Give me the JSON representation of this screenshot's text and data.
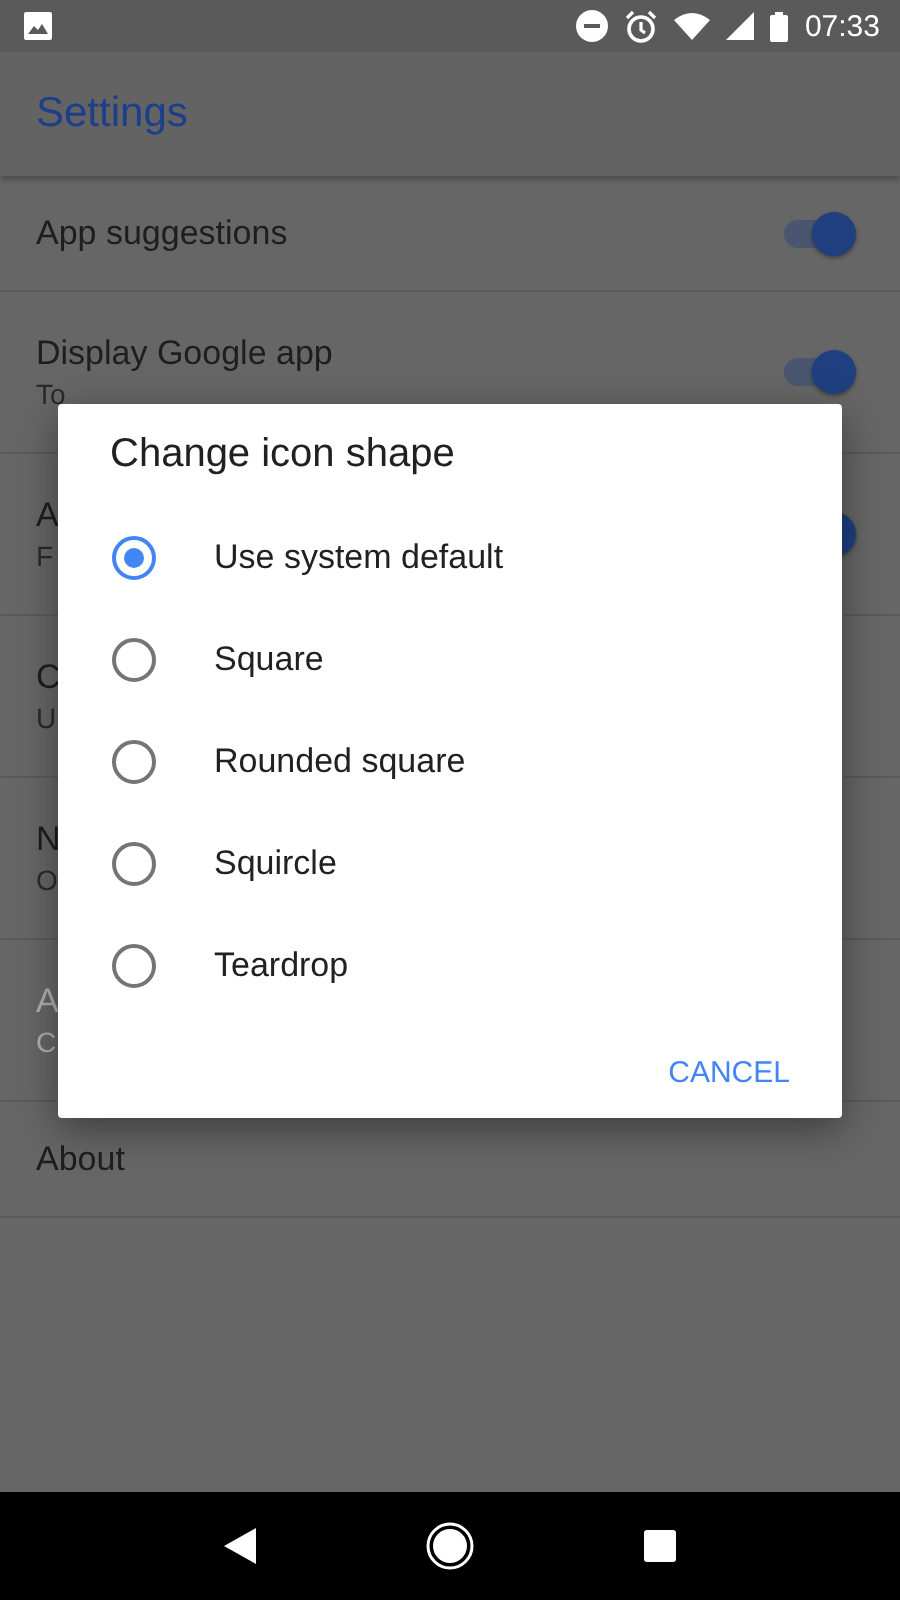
{
  "status_bar": {
    "time": "07:33"
  },
  "toolbar": {
    "title": "Settings"
  },
  "settings": [
    {
      "title": "App suggestions",
      "toggle": {
        "on": true
      },
      "disabled": false
    },
    {
      "title": "Display Google app",
      "subtitle": "To",
      "toggle": {
        "on": true
      },
      "disabled": false
    },
    {
      "title": "A",
      "subtitle": "F",
      "toggle": {
        "on": true
      },
      "disabled": false
    },
    {
      "title": "C",
      "subtitle": "U",
      "disabled": false
    },
    {
      "title": "N",
      "subtitle": "O",
      "disabled": false
    },
    {
      "title": "A",
      "subtitle": "C",
      "disabled": true
    },
    {
      "title": "About",
      "disabled": false
    }
  ],
  "dialog": {
    "title": "Change icon shape",
    "options": [
      {
        "label": "Use system default",
        "selected": true
      },
      {
        "label": "Square",
        "selected": false
      },
      {
        "label": "Rounded square",
        "selected": false
      },
      {
        "label": "Squircle",
        "selected": false
      },
      {
        "label": "Teardrop",
        "selected": false
      }
    ],
    "buttons": [
      "CANCEL"
    ]
  }
}
